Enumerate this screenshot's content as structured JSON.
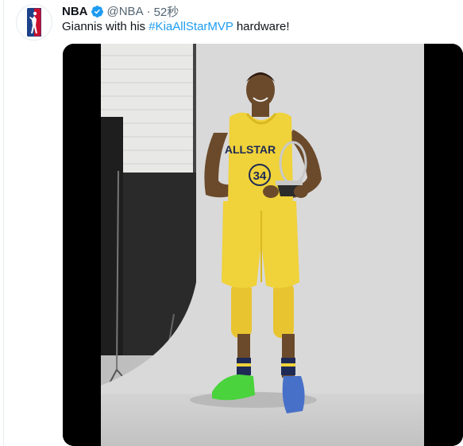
{
  "tweet": {
    "author": {
      "display_name": "NBA",
      "handle": "@NBA",
      "verified": true,
      "avatar_icon": "nba-logo-icon"
    },
    "separator": "·",
    "timestamp": "52秒",
    "text": {
      "before": "Giannis with his ",
      "hashtag": "#KiaAllStarMVP",
      "after": " hardware!"
    },
    "media": {
      "type": "video",
      "jersey_wordmark": "ALLSTAR",
      "jersey_number": "34"
    }
  },
  "colors": {
    "link": "#1d9bf0",
    "verified_badge": "#1d9bf0",
    "secondary_text": "#536471",
    "jersey_yellow": "#f0d23a"
  }
}
